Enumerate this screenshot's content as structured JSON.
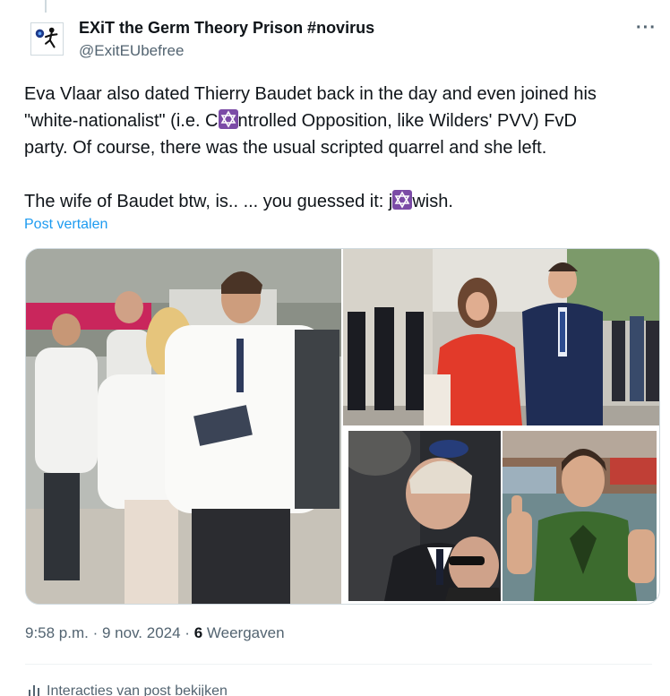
{
  "author": {
    "name": "EXiT the Germ Theory Prison #novirus",
    "handle": "@ExitEUbefree",
    "avatar_icon": "soccer-kick-icon"
  },
  "more_label": "···",
  "tweet": {
    "line1": "Eva Vlaar also dated Thierry Baudet back in the day and even joined his",
    "line2_a": "\"white-nationalist\" (i.e. C",
    "line2_b": "ntrolled Opposition, like Wilders' PVV) FvD",
    "line3": "party. Of course, there was the usual scripted quarrel and she left.",
    "line5_a": "The wife of Baudet btw, is.. ... you guessed it: j",
    "line5_b": "wish.",
    "emoji_icon": "star-of-david-icon",
    "emoji_color": "#7b4ba6"
  },
  "translate_label": "Post vertalen",
  "media": [
    {
      "name": "photo-street-campaign"
    },
    {
      "name": "photo-couple-event"
    },
    {
      "name": "photo-man-kippah"
    },
    {
      "name": "photo-man-green-shirt"
    }
  ],
  "meta": {
    "time": "9:58 p.m.",
    "sep": " · ",
    "date": "9 nov. 2024",
    "views_count": "6",
    "views_label": "Weergaven"
  },
  "interactions_label": "Interacties van post bekijken",
  "colors": {
    "link": "#1d9bf0",
    "secondary": "#536471",
    "text": "#0f1419"
  }
}
